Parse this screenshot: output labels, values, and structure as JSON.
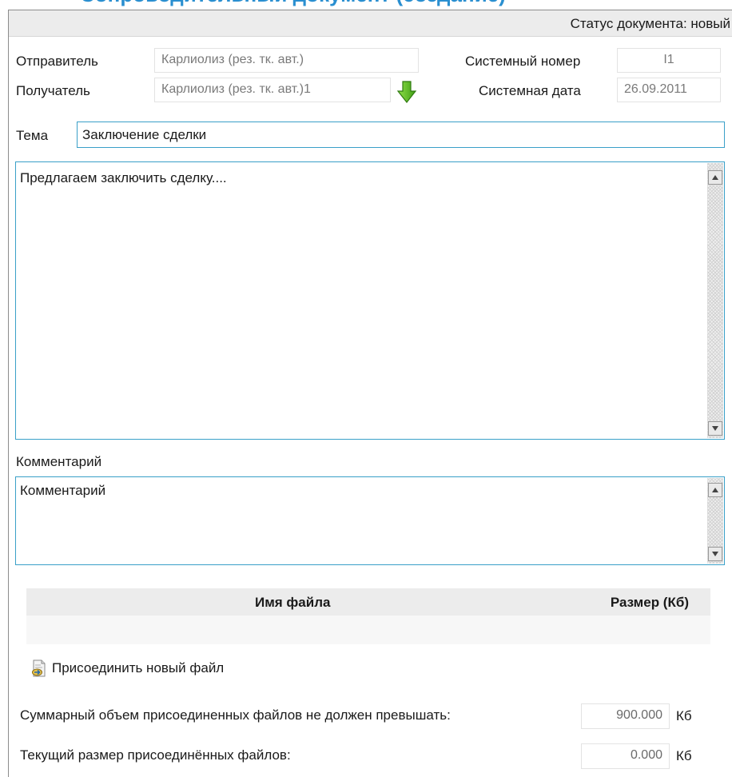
{
  "header": {
    "heading": "Сопроводительный документ (создание)",
    "status_label": "Статус документа: новый"
  },
  "sender": {
    "label": "Отправитель",
    "value": "Карлиолиз (рез. тк. авт.)"
  },
  "recipient": {
    "label": "Получатель",
    "value": "Карлиолиз (рез. тк. авт.)1",
    "select_icon": "green-down-arrow-icon"
  },
  "system_number": {
    "label": "Системный номер",
    "value": "I1"
  },
  "system_date": {
    "label": "Системная дата",
    "value": "26.09.2011"
  },
  "subject": {
    "label": "Тема",
    "value": "Заключение сделки"
  },
  "body": {
    "value": "Предлагаем заключить сделку...."
  },
  "comment": {
    "label": "Комментарий",
    "value": "Комментарий"
  },
  "files": {
    "columns": [
      "Имя файла",
      "Размер (Кб)"
    ],
    "rows": [],
    "attach_label": "Присоединить новый файл",
    "attach_icon": "attach-file-icon"
  },
  "limits": {
    "max_label": "Суммарный объем присоединенных файлов не должен превышать:",
    "max_value": "900.000",
    "max_unit": "Кб",
    "current_label": "Текущий размер присоединённых файлов:",
    "current_value": "0.000",
    "current_unit": "Кб"
  },
  "colors": {
    "accent": "#3aa0c8",
    "heading": "#2a8fd0",
    "arrow": "#5fbf2a"
  }
}
